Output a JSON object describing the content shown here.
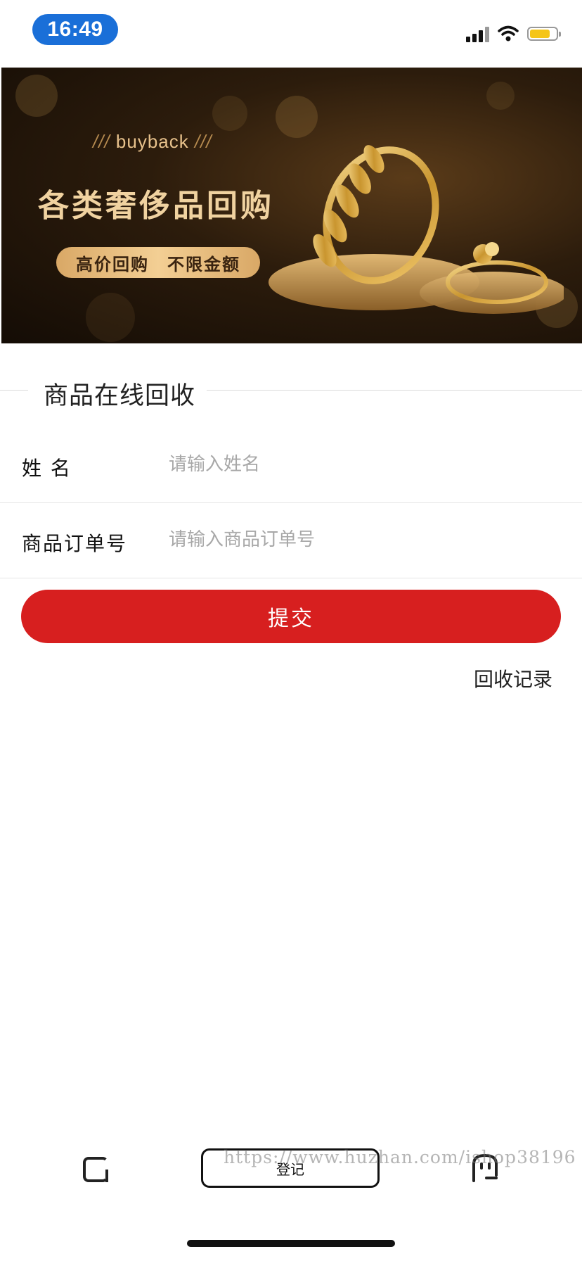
{
  "status_bar": {
    "time": "16:49",
    "battery_level": 0.78,
    "signal_icon": "cellular-signal-icon",
    "wifi_icon": "wifi-icon",
    "battery_icon": "battery-icon"
  },
  "banner": {
    "tagline": "buyback",
    "tagline_decoration": "///",
    "headline": "各类奢侈品回购",
    "pill_text": "高价回购　不限金额",
    "colors": {
      "background": "#2c1c0c",
      "gold": "#e8c28c"
    }
  },
  "section": {
    "title": "商品在线回收"
  },
  "form": {
    "name": {
      "label": "姓 名",
      "placeholder": "请输入姓名",
      "value": ""
    },
    "order": {
      "label": "商品订单号",
      "placeholder": "请输入商品订单号",
      "value": ""
    },
    "submit_label": "提交",
    "records_link": "回收记录"
  },
  "bottom_bar": {
    "left_icon": "square-bracket-icon",
    "register_label": "登记",
    "right_icon": "chat-face-icon",
    "watermark": "https://www.huzhan.com/ishop38196"
  },
  "colors": {
    "accent": "#d71f1f",
    "time_pill": "#1a6fd8",
    "battery": "#f5c518"
  }
}
